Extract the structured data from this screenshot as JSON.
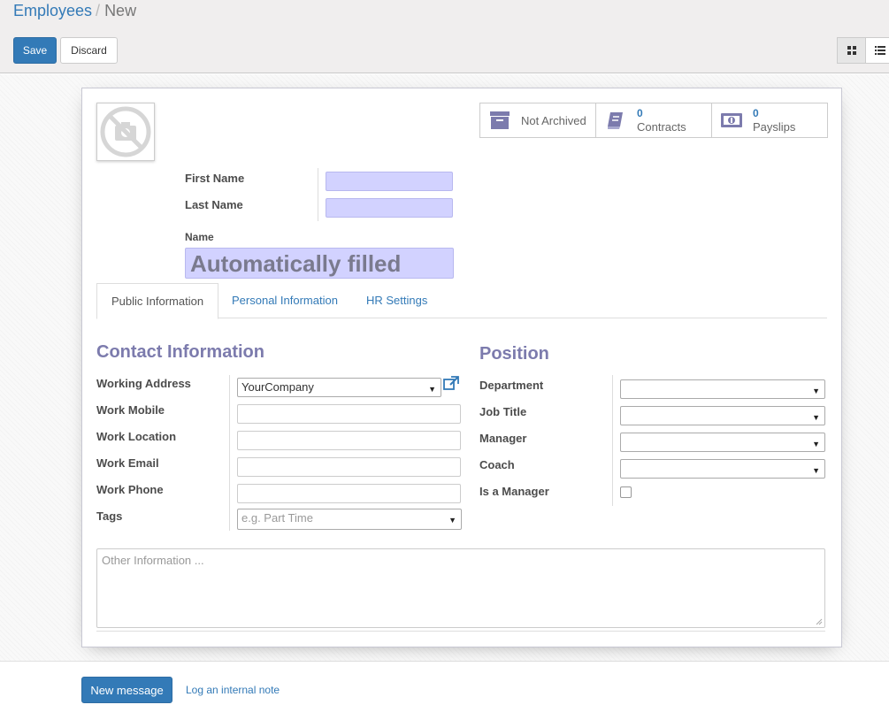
{
  "breadcrumb": {
    "parent": "Employees",
    "separator": "/",
    "current": "New"
  },
  "toolbar": {
    "save_label": "Save",
    "discard_label": "Discard"
  },
  "view_switcher": {
    "icons": [
      "kanban-icon",
      "list-icon"
    ]
  },
  "stat_buttons": {
    "archive": {
      "label": "Not Archived",
      "icon": "archive-icon"
    },
    "contracts": {
      "count": "0",
      "label": "Contracts",
      "icon": "book-icon"
    },
    "payslips": {
      "count": "0",
      "label": "Payslips",
      "icon": "money-icon"
    }
  },
  "header_fields": {
    "first_name_label": "First Name",
    "first_name_value": "",
    "last_name_label": "Last Name",
    "last_name_value": "",
    "name_label": "Name",
    "name_value": "Automatically filled"
  },
  "tabs": [
    {
      "label": "Public Information",
      "active": true
    },
    {
      "label": "Personal Information",
      "active": false
    },
    {
      "label": "HR Settings",
      "active": false
    }
  ],
  "contact_section": {
    "title": "Contact Information",
    "working_address_label": "Working Address",
    "working_address_value": "YourCompany",
    "work_mobile_label": "Work Mobile",
    "work_mobile_value": "",
    "work_location_label": "Work Location",
    "work_location_value": "",
    "work_email_label": "Work Email",
    "work_email_value": "",
    "work_phone_label": "Work Phone",
    "work_phone_value": "",
    "tags_label": "Tags",
    "tags_placeholder": "e.g. Part Time"
  },
  "position_section": {
    "title": "Position",
    "department_label": "Department",
    "department_value": "",
    "job_title_label": "Job Title",
    "job_title_value": "",
    "manager_label": "Manager",
    "manager_value": "",
    "coach_label": "Coach",
    "coach_value": "",
    "is_manager_label": "Is a Manager",
    "is_manager_checked": false
  },
  "notes": {
    "placeholder": "Other Information ..."
  },
  "chatter": {
    "new_message_label": "New message",
    "log_note_label": "Log an internal note"
  },
  "colors": {
    "primary": "#337ab7",
    "required_field": "#d2d2ff",
    "section_title": "#7c7bad"
  }
}
